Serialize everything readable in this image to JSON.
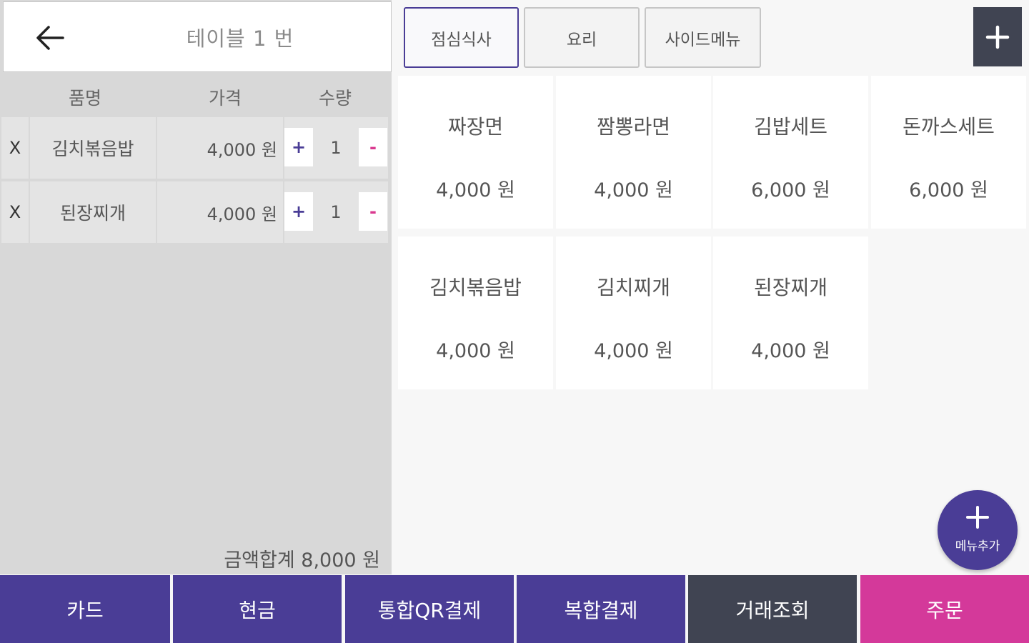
{
  "header": {
    "back_icon": "arrow-left-icon",
    "title": "테이블 1 번"
  },
  "order": {
    "columns": {
      "name": "품명",
      "price": "가격",
      "qty": "수량"
    },
    "items": [
      {
        "delete": "X",
        "name": "김치볶음밥",
        "price": "4,000 원",
        "plus": "+",
        "qty": "1",
        "minus": "-"
      },
      {
        "delete": "X",
        "name": "된장찌개",
        "price": "4,000 원",
        "plus": "+",
        "qty": "1",
        "minus": "-"
      }
    ],
    "total": "금액합계 8,000 원"
  },
  "tabs": [
    {
      "label": "점심식사",
      "active": true
    },
    {
      "label": "요리",
      "active": false
    },
    {
      "label": "사이드메뉴",
      "active": false
    }
  ],
  "add_category_icon": "plus-icon",
  "menu": [
    {
      "name": "짜장면",
      "price": "4,000 원"
    },
    {
      "name": "짬뽕라면",
      "price": "4,000 원"
    },
    {
      "name": "김밥세트",
      "price": "6,000 원"
    },
    {
      "name": "돈까스세트",
      "price": "6,000 원"
    },
    {
      "name": "김치볶음밥",
      "price": "4,000 원"
    },
    {
      "name": "김치찌개",
      "price": "4,000 원"
    },
    {
      "name": "된장찌개",
      "price": "4,000 원"
    }
  ],
  "fab": {
    "icon": "plus-icon",
    "label": "메뉴추가"
  },
  "bottom": [
    {
      "label": "카드",
      "color": "#4a3d96"
    },
    {
      "label": "현금",
      "color": "#4a3d96"
    },
    {
      "label": "통합QR결제",
      "color": "#4a3d96"
    },
    {
      "label": "복합결제",
      "color": "#4a3d96"
    },
    {
      "label": "거래조회",
      "color": "#404452"
    },
    {
      "label": "주문",
      "color": "#d4399a"
    }
  ]
}
